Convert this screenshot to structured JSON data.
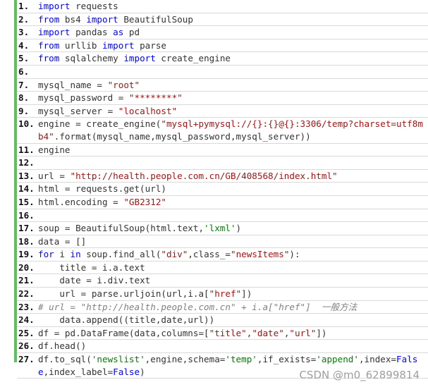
{
  "lines": [
    {
      "n": "1.",
      "seg": [
        [
          "kw",
          "import"
        ],
        [
          "t",
          " requests"
        ]
      ]
    },
    {
      "n": "2.",
      "seg": [
        [
          "kw",
          "from"
        ],
        [
          "t",
          " bs4 "
        ],
        [
          "kw",
          "import"
        ],
        [
          "t",
          " BeautifulSoup"
        ]
      ]
    },
    {
      "n": "3.",
      "seg": [
        [
          "kw",
          "import"
        ],
        [
          "t",
          " pandas "
        ],
        [
          "kw",
          "as"
        ],
        [
          "t",
          " pd"
        ]
      ]
    },
    {
      "n": "4.",
      "seg": [
        [
          "kw",
          "from"
        ],
        [
          "t",
          " urllib "
        ],
        [
          "kw",
          "import"
        ],
        [
          "t",
          " parse"
        ]
      ]
    },
    {
      "n": "5.",
      "seg": [
        [
          "kw",
          "from"
        ],
        [
          "t",
          " sqlalchemy "
        ],
        [
          "kw",
          "import"
        ],
        [
          "t",
          " create_engine"
        ]
      ]
    },
    {
      "n": "6.",
      "seg": []
    },
    {
      "n": "7.",
      "seg": [
        [
          "t",
          "mysql_name = "
        ],
        [
          "str",
          "\"root\""
        ]
      ]
    },
    {
      "n": "8.",
      "seg": [
        [
          "t",
          "mysql_password = "
        ],
        [
          "str",
          "\"********\""
        ]
      ]
    },
    {
      "n": "9.",
      "seg": [
        [
          "t",
          "mysql_server = "
        ],
        [
          "str",
          "\"localhost\""
        ]
      ]
    },
    {
      "n": "10.",
      "seg": [
        [
          "t",
          "engine = create_engine("
        ],
        [
          "str",
          "\"mysql+pymysql://{}:{}@{}:3306/temp?charset=utf8mb4\""
        ],
        [
          "t",
          ".format(mysql_name,mysql_password,mysql_server))"
        ]
      ]
    },
    {
      "n": "11.",
      "seg": [
        [
          "t",
          "engine"
        ]
      ]
    },
    {
      "n": "12.",
      "seg": []
    },
    {
      "n": "13.",
      "seg": [
        [
          "t",
          "url = "
        ],
        [
          "str",
          "\"http://health.people.com.cn/GB/408568/index.html\""
        ]
      ]
    },
    {
      "n": "14.",
      "seg": [
        [
          "t",
          "html = requests.get(url)"
        ]
      ]
    },
    {
      "n": "15.",
      "seg": [
        [
          "t",
          "html.encoding = "
        ],
        [
          "str",
          "\"GB2312\""
        ]
      ]
    },
    {
      "n": "16.",
      "seg": []
    },
    {
      "n": "17.",
      "seg": [
        [
          "t",
          "soup = BeautifulSoup(html.text,"
        ],
        [
          "str2",
          "'lxml'"
        ],
        [
          "t",
          ")"
        ]
      ]
    },
    {
      "n": "18.",
      "seg": [
        [
          "t",
          "data = []"
        ]
      ]
    },
    {
      "n": "19.",
      "seg": [
        [
          "kw",
          "for"
        ],
        [
          "t",
          " i "
        ],
        [
          "kw",
          "in"
        ],
        [
          "t",
          " soup.find_all("
        ],
        [
          "str",
          "\"div\""
        ],
        [
          "t",
          ",class_="
        ],
        [
          "str",
          "\"newsItems\""
        ],
        [
          "t",
          "):"
        ]
      ]
    },
    {
      "n": "20.",
      "seg": [
        [
          "t",
          "    title = i.a.text"
        ]
      ]
    },
    {
      "n": "21.",
      "seg": [
        [
          "t",
          "    date = i.div.text"
        ]
      ]
    },
    {
      "n": "22.",
      "seg": [
        [
          "t",
          "    url = parse.urljoin(url,i.a["
        ],
        [
          "str",
          "\"href\""
        ],
        [
          "t",
          "])"
        ]
      ]
    },
    {
      "n": "23.",
      "seg": [
        [
          "cmt",
          "# url = \"http://health.people.com.cn\" + i.a[\"href\"]  一般方法"
        ]
      ]
    },
    {
      "n": "24.",
      "seg": [
        [
          "t",
          "    data.append((title,date,url))"
        ]
      ]
    },
    {
      "n": "25.",
      "seg": [
        [
          "t",
          "df = pd.DataFrame(data,columns=["
        ],
        [
          "str",
          "\"title\""
        ],
        [
          "t",
          ","
        ],
        [
          "str",
          "\"date\""
        ],
        [
          "t",
          ","
        ],
        [
          "str",
          "\"url\""
        ],
        [
          "t",
          "])"
        ]
      ]
    },
    {
      "n": "26.",
      "seg": [
        [
          "t",
          "df.head()"
        ]
      ]
    },
    {
      "n": "27.",
      "seg": [
        [
          "t",
          "df.to_sql("
        ],
        [
          "str2",
          "'newslist'"
        ],
        [
          "t",
          ",engine,schema="
        ],
        [
          "str2",
          "'temp'"
        ],
        [
          "t",
          ",if_exists="
        ],
        [
          "str2",
          "'append'"
        ],
        [
          "t",
          ",index="
        ],
        [
          "kw",
          "False"
        ],
        [
          "t",
          ",index_label="
        ],
        [
          "kw",
          "False"
        ],
        [
          "t",
          ")"
        ]
      ]
    }
  ],
  "watermark": "CSDN @m0_62899814"
}
